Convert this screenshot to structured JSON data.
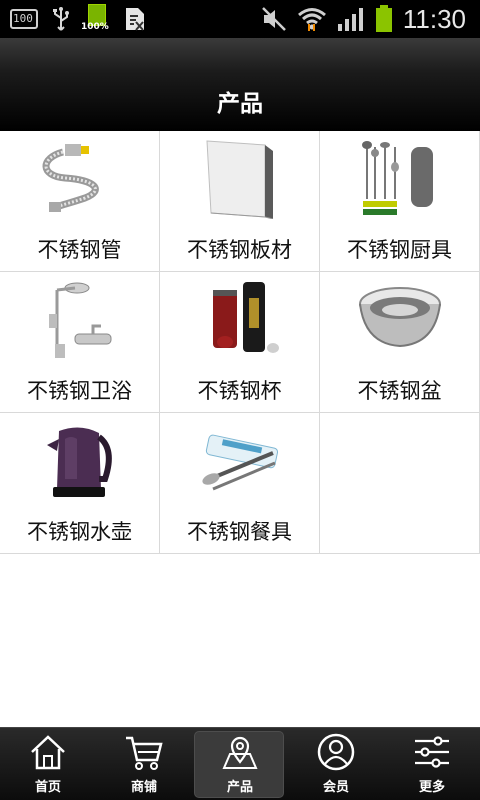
{
  "status_bar": {
    "time": "11:30",
    "battery_percent_label": "100",
    "battery_level_label": "100%"
  },
  "header": {
    "title": "产品"
  },
  "products": [
    {
      "label": "不锈钢管",
      "icon": "hose-image"
    },
    {
      "label": "不锈钢板材",
      "icon": "sheet-image"
    },
    {
      "label": "不锈钢厨具",
      "icon": "kitchen-utensils-image"
    },
    {
      "label": "不锈钢卫浴",
      "icon": "shower-image"
    },
    {
      "label": "不锈钢杯",
      "icon": "thermos-image"
    },
    {
      "label": "不锈钢盆",
      "icon": "basin-image"
    },
    {
      "label": "不锈钢水壶",
      "icon": "kettle-image"
    },
    {
      "label": "不锈钢餐具",
      "icon": "cutlery-image"
    }
  ],
  "bottom_nav": {
    "items": [
      {
        "label": "首页",
        "icon": "home-icon"
      },
      {
        "label": "商铺",
        "icon": "cart-icon"
      },
      {
        "label": "产品",
        "icon": "map-pin-icon",
        "active": true
      },
      {
        "label": "会员",
        "icon": "user-icon"
      },
      {
        "label": "更多",
        "icon": "sliders-icon"
      }
    ]
  }
}
